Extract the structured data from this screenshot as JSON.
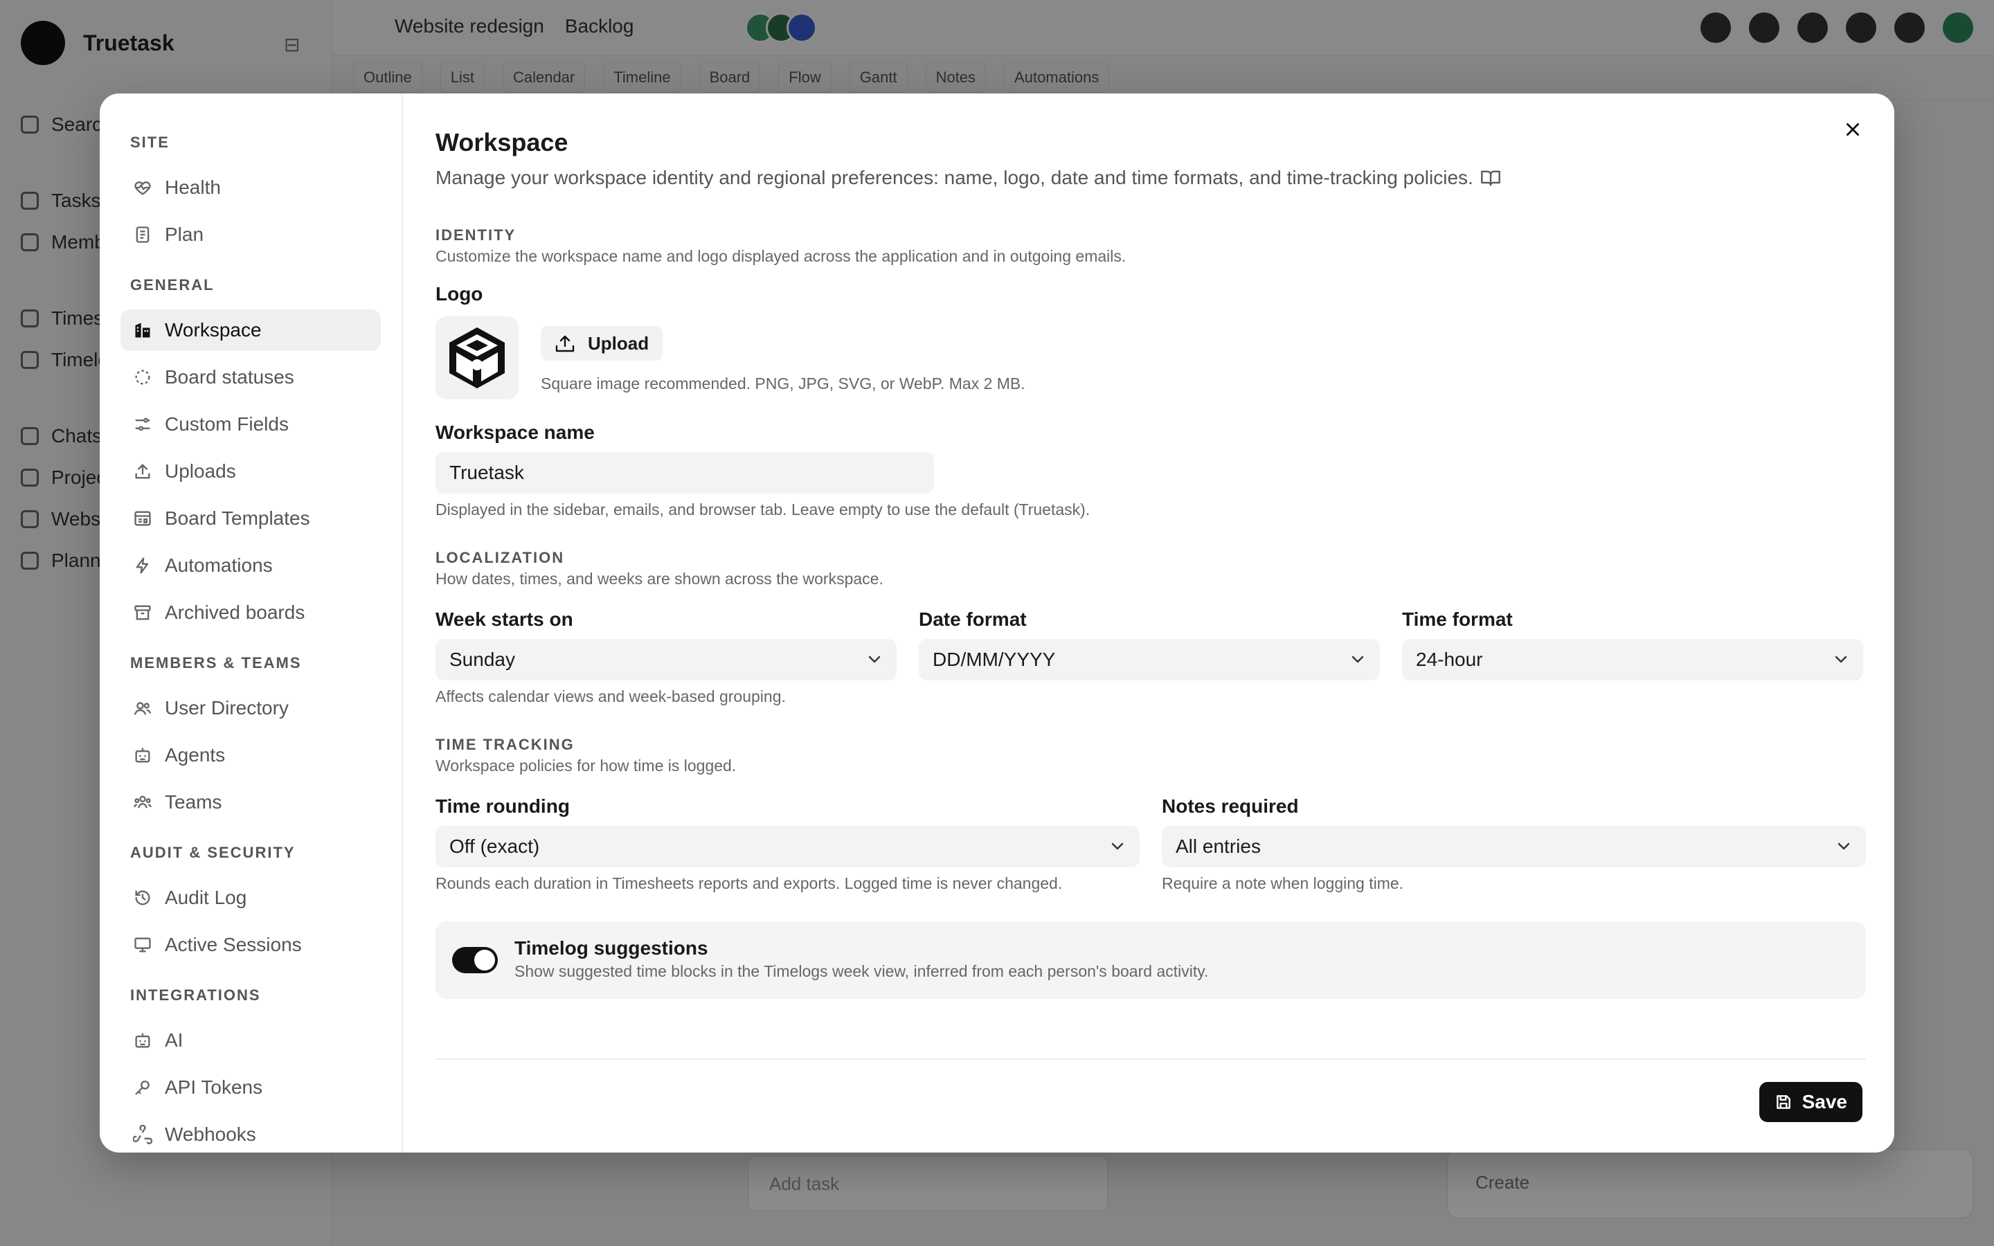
{
  "background": {
    "brand": "Truetask",
    "nav_items": [
      "Search",
      "Tasks",
      "Members",
      "Timesheets",
      "Timelogs",
      "Chats",
      "Projects",
      "Websites",
      "Planning"
    ],
    "breadcrumb": [
      "Website redesign",
      "Backlog"
    ],
    "views": [
      "Outline",
      "List",
      "Calendar",
      "Timeline",
      "Board",
      "Flow",
      "Gantt",
      "Notes",
      "Automations"
    ],
    "bottom_input_placeholder": "Add task",
    "bottom_bar_label": "Create"
  },
  "modal": {
    "close_label": "Close"
  },
  "settings_nav": {
    "sections": [
      {
        "title": "SITE",
        "items": [
          {
            "label": "Health",
            "icon": "heart-pulse-icon"
          },
          {
            "label": "Plan",
            "icon": "receipt-icon"
          }
        ]
      },
      {
        "title": "GENERAL",
        "items": [
          {
            "label": "Workspace",
            "icon": "building-icon",
            "active": true
          },
          {
            "label": "Board statuses",
            "icon": "circle-dashed-icon"
          },
          {
            "label": "Custom Fields",
            "icon": "sliders-icon"
          },
          {
            "label": "Uploads",
            "icon": "upload-icon"
          },
          {
            "label": "Board Templates",
            "icon": "template-icon"
          },
          {
            "label": "Automations",
            "icon": "bolt-icon"
          },
          {
            "label": "Archived boards",
            "icon": "archive-icon"
          }
        ]
      },
      {
        "title": "MEMBERS & TEAMS",
        "items": [
          {
            "label": "User Directory",
            "icon": "users-icon"
          },
          {
            "label": "Agents",
            "icon": "bot-icon"
          },
          {
            "label": "Teams",
            "icon": "team-icon"
          }
        ]
      },
      {
        "title": "AUDIT & SECURITY",
        "items": [
          {
            "label": "Audit Log",
            "icon": "history-icon"
          },
          {
            "label": "Active Sessions",
            "icon": "monitor-icon"
          }
        ]
      },
      {
        "title": "INTEGRATIONS",
        "items": [
          {
            "label": "AI",
            "icon": "bot-icon"
          },
          {
            "label": "API Tokens",
            "icon": "key-icon"
          },
          {
            "label": "Webhooks",
            "icon": "webhook-icon"
          }
        ]
      }
    ]
  },
  "page": {
    "title": "Workspace",
    "description": "Manage your workspace identity and regional preferences: name, logo, date and time formats, and time-tracking policies."
  },
  "identity": {
    "title": "IDENTITY",
    "description": "Customize the workspace name and logo displayed across the application and in outgoing emails.",
    "logo_label": "Logo",
    "upload_label": "Upload",
    "logo_help": "Square image recommended. PNG, JPG, SVG, or WebP. Max 2 MB.",
    "name_label": "Workspace name",
    "name_value": "Truetask",
    "name_help": "Displayed in the sidebar, emails, and browser tab. Leave empty to use the default (Truetask)."
  },
  "localization": {
    "title": "LOCALIZATION",
    "description": "How dates, times, and weeks are shown across the workspace.",
    "week_label": "Week starts on",
    "week_value": "Sunday",
    "week_help": "Affects calendar views and week-based grouping.",
    "date_label": "Date format",
    "date_value": "DD/MM/YYYY",
    "time_label": "Time format",
    "time_value": "24-hour"
  },
  "time_tracking": {
    "title": "TIME TRACKING",
    "description": "Workspace policies for how time is logged.",
    "rounding_label": "Time rounding",
    "rounding_value": "Off (exact)",
    "rounding_help": "Rounds each duration in Timesheets reports and exports. Logged time is never changed.",
    "notes_label": "Notes required",
    "notes_value": "All entries",
    "notes_help": "Require a note when logging time.",
    "suggestions_title": "Timelog suggestions",
    "suggestions_desc": "Show suggested time blocks in the Timelogs week view, inferred from each person's board activity.",
    "suggestions_enabled": true
  },
  "footer": {
    "save_label": "Save"
  },
  "colors": {
    "primary": "#111111",
    "input_bg": "#f3f3f3",
    "active_nav_bg": "#efefef"
  }
}
